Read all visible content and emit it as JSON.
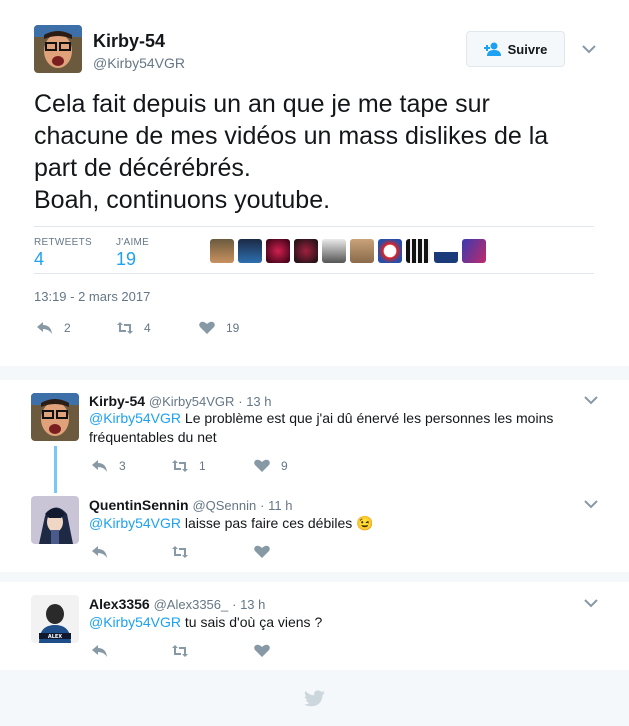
{
  "tweet": {
    "name": "Kirby-54",
    "handle": "@Kirby54VGR",
    "follow_label": "Suivre",
    "text_lines": [
      "Cela fait depuis un an que je me tape sur",
      "chacune de mes vidéos un mass dislikes de la",
      "part de décérébrés.",
      "Boah, continuons youtube."
    ],
    "retweets_label": "RETWEETS",
    "retweets_value": "4",
    "likes_label": "J'AIME",
    "likes_value": "19",
    "date": "13:19 - 2 mars 2017",
    "actions": {
      "replies": "2",
      "retweets": "4",
      "likes": "19"
    }
  },
  "replies": [
    {
      "name": "Kirby-54",
      "handle": "@Kirby54VGR",
      "time": "· 13 h",
      "mention": "@Kirby54VGR",
      "text_line1": " Le problème est que j'ai dû énervé les personnes les moins",
      "text_line2": "fréquentables du net",
      "counts": {
        "replies": "3",
        "retweets": "1",
        "likes": "9"
      }
    },
    {
      "name": "QuentinSennin",
      "handle": "@QSennin",
      "time": "· 11 h",
      "mention": "@Kirby54VGR",
      "text_line1": " laisse pas faire ces débiles ",
      "emoji": "😉"
    },
    {
      "name": "Alex3356",
      "handle": "@Alex3356_",
      "time": "· 13 h",
      "mention": "@Kirby54VGR",
      "text_line1": " tu sais d'où ça viens ?"
    }
  ],
  "icons": [
    "add-user-icon",
    "chevron-down-icon",
    "reply-icon",
    "retweet-icon",
    "heart-icon",
    "twitter-bird-icon"
  ],
  "colors": {
    "accent": "#1da1f2",
    "muted": "#657786",
    "border": "#e1e8ed",
    "background": "#f5f8fa"
  }
}
